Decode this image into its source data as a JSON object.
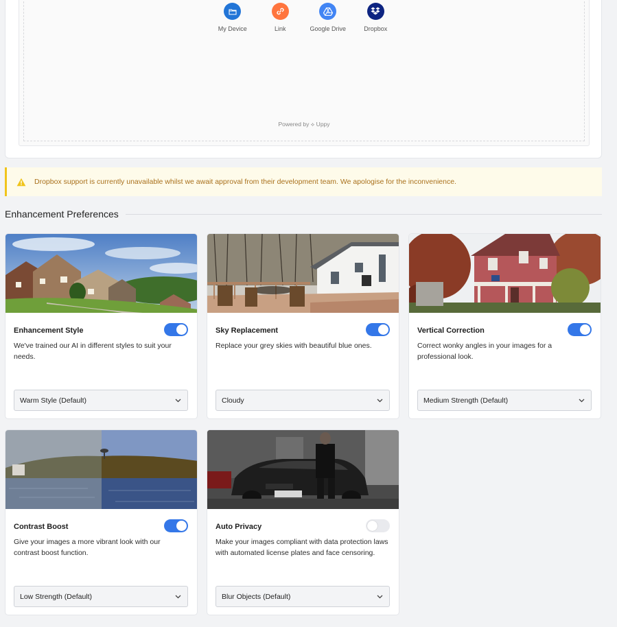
{
  "upload": {
    "sources": [
      {
        "label": "My Device",
        "icon": "folder-icon",
        "color": "#2275d7"
      },
      {
        "label": "Link",
        "icon": "link-icon",
        "color": "#ff753e"
      },
      {
        "label": "Google Drive",
        "icon": "google-drive-icon",
        "color": "#4285f4"
      },
      {
        "label": "Dropbox",
        "icon": "dropbox-icon",
        "color": "#0d2481"
      }
    ],
    "powered_by": "Powered by ⟡ Uppy"
  },
  "warning": {
    "text": "Dropbox support is currently unavailable whilst we await approval from their development team. We apologise for the inconvenience.",
    "icon": "warning-icon",
    "color": "#f0c41b"
  },
  "preferences": {
    "heading": "Enhancement Preferences",
    "accent": "#3477e8",
    "cards": [
      {
        "title": "Enhancement Style",
        "desc": "We've trained our AI in different styles to suit your needs.",
        "enabled": true,
        "option": "Warm Style (Default)"
      },
      {
        "title": "Sky Replacement",
        "desc": "Replace your grey skies with beautiful blue ones.",
        "enabled": true,
        "option": "Cloudy"
      },
      {
        "title": "Vertical Correction",
        "desc": "Correct wonky angles in your images for a professional look.",
        "enabled": true,
        "option": "Medium Strength (Default)"
      },
      {
        "title": "Contrast Boost",
        "desc": "Give your images a more vibrant look with our contrast boost function.",
        "enabled": true,
        "option": "Low Strength (Default)"
      },
      {
        "title": "Auto Privacy",
        "desc": "Make your images compliant with data protection laws with automated license plates and face censoring.",
        "enabled": false,
        "option": "Blur Objects (Default)"
      }
    ]
  }
}
